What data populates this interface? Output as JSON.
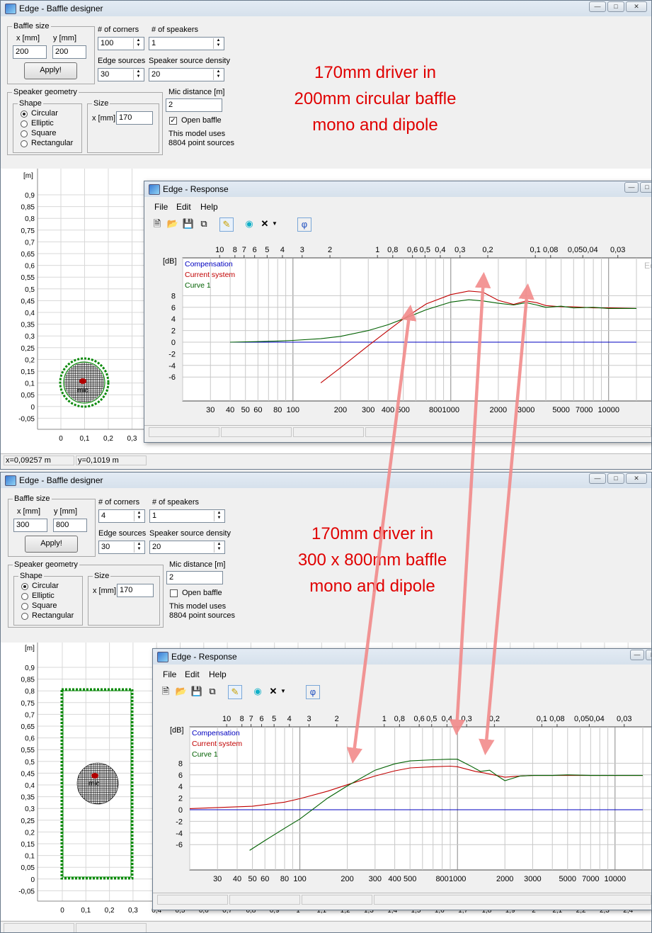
{
  "baffle1": {
    "title": "Edge - Baffle designer",
    "baffle_size_label": "Baffle size",
    "x_label": "x [mm]",
    "y_label": "y [mm]",
    "x_value": "200",
    "y_value": "200",
    "apply": "Apply!",
    "corners_label": "# of corners",
    "corners_value": "100",
    "speakers_label": "# of speakers",
    "speakers_value": "1",
    "edge_label": "Edge sources",
    "edge_value": "30",
    "density_label": "Speaker source density",
    "density_value": "20",
    "geometry_label": "Speaker geometry",
    "shape_label": "Shape",
    "shapes": [
      "Circular",
      "Elliptic",
      "Square",
      "Rectangular"
    ],
    "size_label": "Size",
    "size_x_label": "x [mm]",
    "size_value": "170",
    "mic_label": "Mic distance [m]",
    "mic_value": "2",
    "open_baffle": "Open baffle",
    "open_checked": true,
    "uses1": "This model uses",
    "uses2": "8804 point sources",
    "y_unit": "[m]",
    "y_ticks": [
      "0,9",
      "0,85",
      "0,8",
      "0,75",
      "0,7",
      "0,65",
      "0,6",
      "0,55",
      "0,5",
      "0,45",
      "0,4",
      "0,35",
      "0,3",
      "0,25",
      "0,2",
      "0,15",
      "0,1",
      "0,05",
      "0",
      "-0,05"
    ],
    "x_ticks": [
      "0",
      "0,1",
      "0,2",
      "0,3"
    ],
    "status_x": "x=0,09257 m",
    "status_y": "y=0,1019 m"
  },
  "baffle2": {
    "title": "Edge - Baffle designer",
    "baffle_size_label": "Baffle size",
    "x_label": "x [mm]",
    "y_label": "y [mm]",
    "x_value": "300",
    "y_value": "800",
    "apply": "Apply!",
    "corners_label": "# of corners",
    "corners_value": "4",
    "speakers_label": "# of speakers",
    "speakers_value": "1",
    "edge_label": "Edge sources",
    "edge_value": "30",
    "density_label": "Speaker source density",
    "density_value": "20",
    "geometry_label": "Speaker geometry",
    "shape_label": "Shape",
    "shapes": [
      "Circular",
      "Elliptic",
      "Square",
      "Rectangular"
    ],
    "size_label": "Size",
    "size_x_label": "x [mm]",
    "size_value": "170",
    "mic_label": "Mic distance [m]",
    "mic_value": "2",
    "open_baffle": "Open baffle",
    "open_checked": false,
    "uses1": "This model uses",
    "uses2": "8804 point sources",
    "y_unit": "[m]",
    "y_ticks": [
      "0,9",
      "0,85",
      "0,8",
      "0,75",
      "0,7",
      "0,65",
      "0,6",
      "0,55",
      "0,5",
      "0,45",
      "0,4",
      "0,35",
      "0,3",
      "0,25",
      "0,2",
      "0,15",
      "0,1",
      "0,05",
      "0",
      "-0,05"
    ],
    "x_ticks": [
      "0",
      "0,1",
      "0,2",
      "0,3",
      "0,4",
      "0,5",
      "0,6",
      "0,7",
      "0,8",
      "0,9",
      "1",
      "1,1",
      "1,2",
      "1,3",
      "1,4",
      "1,5",
      "1,6",
      "1,7",
      "1,8",
      "1,9",
      "2",
      "2,1",
      "2,2",
      "2,3",
      "2,4"
    ]
  },
  "response": {
    "title": "Edge - Response",
    "menus": [
      "File",
      "Edit",
      "Help"
    ],
    "phi": "φ",
    "db_unit": "[dB]",
    "db_ticks": [
      "8",
      "6",
      "4",
      "2",
      "0",
      "-2",
      "-4",
      "-6"
    ],
    "freq_ticks": [
      "30",
      "40",
      "50",
      "60",
      "80",
      "100",
      "200",
      "300",
      "400",
      "500",
      "800",
      "1000",
      "2000",
      "3000",
      "5000",
      "7000",
      "10000"
    ],
    "wl_ticks": [
      "10",
      "8",
      "7",
      "6",
      "5",
      "4",
      "3",
      "2",
      "1",
      "0,8",
      "0,6",
      "0,5",
      "0,4",
      "0,3",
      "0,2",
      "0,1",
      "0,08",
      "0,050,04",
      "0,03"
    ],
    "legend": [
      "Compensation",
      "Current system",
      "Curve 1"
    ],
    "corner_text": "Ec"
  },
  "annotations": {
    "top": [
      "170mm driver in",
      "200mm circular baffle",
      "mono and dipole"
    ],
    "bottom": [
      "170mm driver in",
      "300 x 800mm baffle",
      "mono and dipole"
    ]
  },
  "colors": {
    "annotation": "#e00000",
    "compensation": "#0000c0",
    "current_system": "#c00000",
    "curve1": "#006000",
    "arrow": "#f28b8b"
  },
  "chart_data": [
    {
      "type": "line",
      "title": "",
      "xlabel": "",
      "ylabel": "[dB]",
      "x_scale": "log",
      "xlim": [
        20,
        15000
      ],
      "ylim": [
        -7,
        10
      ],
      "series": [
        {
          "name": "Compensation",
          "x": [
            40,
            15000
          ],
          "values": [
            0,
            0
          ]
        },
        {
          "name": "Current system",
          "x": [
            150,
            200,
            300,
            400,
            500,
            700,
            1000,
            1300,
            1600,
            2000,
            2500,
            3000,
            3500,
            4000,
            5000,
            6000,
            8000,
            10000,
            15000
          ],
          "values": [
            -7,
            -4.4,
            -0.6,
            2,
            4,
            6.6,
            8.2,
            8.8,
            8.6,
            7.2,
            6.5,
            7.1,
            6.8,
            6.3,
            6.1,
            6.1,
            5.9,
            5.9,
            5.8
          ]
        },
        {
          "name": "Curve 1",
          "x": [
            40,
            60,
            80,
            100,
            150,
            200,
            300,
            400,
            500,
            700,
            1000,
            1300,
            1600,
            2000,
            2500,
            3000,
            3500,
            4000,
            5000,
            6000,
            8000,
            10000,
            15000
          ],
          "values": [
            0,
            0.1,
            0.2,
            0.3,
            0.6,
            1.0,
            2.0,
            3.0,
            4.0,
            5.6,
            6.9,
            7.3,
            7.1,
            6.7,
            6.4,
            6.8,
            6.4,
            6.0,
            6.2,
            5.9,
            6.0,
            5.8,
            5.8
          ]
        }
      ]
    },
    {
      "type": "line",
      "title": "",
      "xlabel": "",
      "ylabel": "[dB]",
      "x_scale": "log",
      "xlim": [
        20,
        15000
      ],
      "ylim": [
        -7,
        10
      ],
      "series": [
        {
          "name": "Compensation",
          "x": [
            20,
            15000
          ],
          "values": [
            0,
            0
          ]
        },
        {
          "name": "Current system",
          "x": [
            20,
            50,
            80,
            100,
            150,
            200,
            300,
            400,
            500,
            700,
            900,
            1000,
            1300,
            1500,
            2000,
            2500,
            3000,
            4000,
            5000,
            7000,
            10000,
            15000
          ],
          "values": [
            0.2,
            0.6,
            1.3,
            1.9,
            3.2,
            4.3,
            5.8,
            6.7,
            7.2,
            7.4,
            7.5,
            7.4,
            6.6,
            6.3,
            5.6,
            5.8,
            5.9,
            5.9,
            5.9,
            5.9,
            5.9,
            5.9
          ]
        },
        {
          "name": "Curve 1",
          "x": [
            48,
            60,
            80,
            100,
            150,
            200,
            300,
            400,
            500,
            700,
            900,
            1000,
            1200,
            1400,
            1600,
            1800,
            2000,
            2500,
            3000,
            4000,
            5000,
            7000,
            10000,
            15000
          ],
          "values": [
            -7,
            -5.3,
            -3.2,
            -1.6,
            2.0,
            4.1,
            6.8,
            7.9,
            8.4,
            8.6,
            8.7,
            8.7,
            7.6,
            6.6,
            6.8,
            5.8,
            5.0,
            5.8,
            5.9,
            5.9,
            6.0,
            5.9,
            5.9,
            5.9
          ]
        }
      ]
    }
  ]
}
